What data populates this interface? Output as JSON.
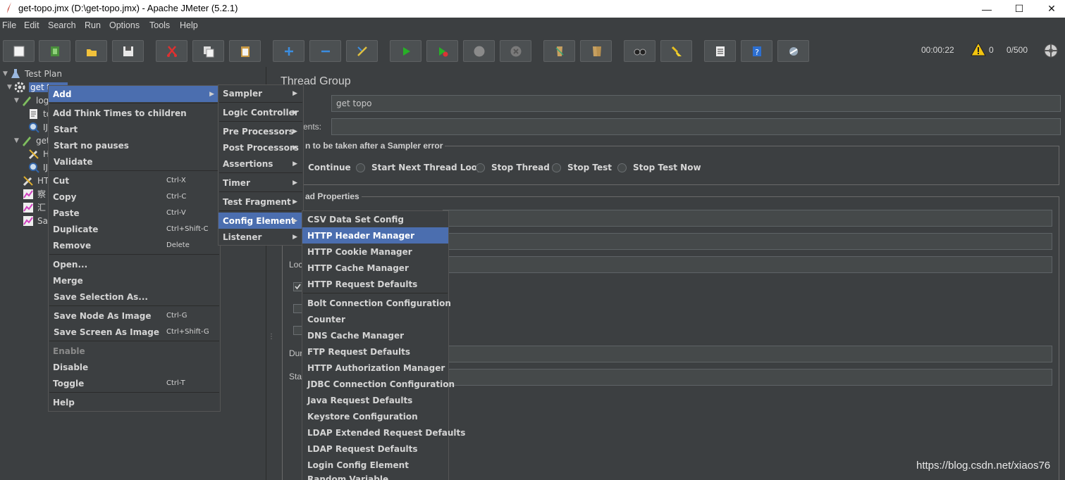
{
  "window": {
    "title": "get-topo.jmx (D:\\get-topo.jmx) - Apache JMeter (5.2.1)",
    "minimize": "—",
    "maximize": "☐",
    "close": "✕"
  },
  "menubar": [
    "File",
    "Edit",
    "Search",
    "Run",
    "Options",
    "Tools",
    "Help"
  ],
  "toolbar": {
    "buttons": [
      "new-icon",
      "templates-icon",
      "open-icon",
      "save-icon",
      "cut-icon",
      "copy-icon",
      "paste-icon",
      "expand-icon",
      "collapse-icon",
      "toggle-icon",
      "start-icon",
      "start-no-pauses-icon",
      "stop-icon",
      "shutdown-icon",
      "clear-icon",
      "clear-all-icon",
      "search-icon",
      "reset-search-icon",
      "function-helper-icon",
      "help-icon",
      "remote-icon"
    ],
    "timer": "00:00:22",
    "warnings": "0",
    "threads": "0/500"
  },
  "tree": {
    "items": [
      "Test Plan",
      "get topo",
      "log",
      "to",
      "IJ",
      "get",
      "H",
      "IJ",
      "HT",
      "察",
      "汇",
      "Sa"
    ]
  },
  "panel": {
    "title": "Thread Group",
    "name_value": "get topo",
    "comments_label": "ents:",
    "error_action_label": "n to be taken after a Sampler error",
    "error_actions": [
      "Continue",
      "Start Next Thread Loop",
      "Stop Thread",
      "Stop Test",
      "Stop Test Now"
    ],
    "thread_props_label": "ad Properties",
    "loop_label": "Loc",
    "duration_label": "Dur",
    "startup_label": "Sta"
  },
  "context_menu": {
    "items": [
      {
        "label": "Add",
        "shortcut": ""
      },
      {
        "label": "Add Think Times to children",
        "shortcut": ""
      },
      {
        "label": "Start",
        "shortcut": ""
      },
      {
        "label": "Start no pauses",
        "shortcut": ""
      },
      {
        "label": "Validate",
        "shortcut": ""
      },
      {
        "label": "Cut",
        "shortcut": "Ctrl-X"
      },
      {
        "label": "Copy",
        "shortcut": "Ctrl-C"
      },
      {
        "label": "Paste",
        "shortcut": "Ctrl-V"
      },
      {
        "label": "Duplicate",
        "shortcut": "Ctrl+Shift-C"
      },
      {
        "label": "Remove",
        "shortcut": "Delete"
      },
      {
        "label": "Open...",
        "shortcut": ""
      },
      {
        "label": "Merge",
        "shortcut": ""
      },
      {
        "label": "Save Selection As...",
        "shortcut": ""
      },
      {
        "label": "Save Node As Image",
        "shortcut": "Ctrl-G"
      },
      {
        "label": "Save Screen As Image",
        "shortcut": "Ctrl+Shift-G"
      },
      {
        "label": "Enable",
        "shortcut": ""
      },
      {
        "label": "Disable",
        "shortcut": ""
      },
      {
        "label": "Toggle",
        "shortcut": "Ctrl-T"
      },
      {
        "label": "Help",
        "shortcut": ""
      }
    ]
  },
  "add_menu": {
    "items": [
      "Sampler",
      "Logic Controller",
      "Pre Processors",
      "Post Processors",
      "Assertions",
      "Timer",
      "Test Fragment",
      "Config Element",
      "Listener"
    ]
  },
  "config_menu": {
    "items": [
      "CSV Data Set Config",
      "HTTP Header Manager",
      "HTTP Cookie Manager",
      "HTTP Cache Manager",
      "HTTP Request Defaults",
      "Bolt Connection Configuration",
      "Counter",
      "DNS Cache Manager",
      "FTP Request Defaults",
      "HTTP Authorization Manager",
      "JDBC Connection Configuration",
      "Java Request Defaults",
      "Keystore Configuration",
      "LDAP Extended Request Defaults",
      "LDAP Request Defaults",
      "Login Config Element",
      "Random Variable"
    ]
  },
  "watermark": "https://blog.csdn.net/xiaos76",
  "colors": {
    "background": "#3c3f41",
    "selection": "#4b6eaf",
    "text": "#d4d4d4"
  }
}
